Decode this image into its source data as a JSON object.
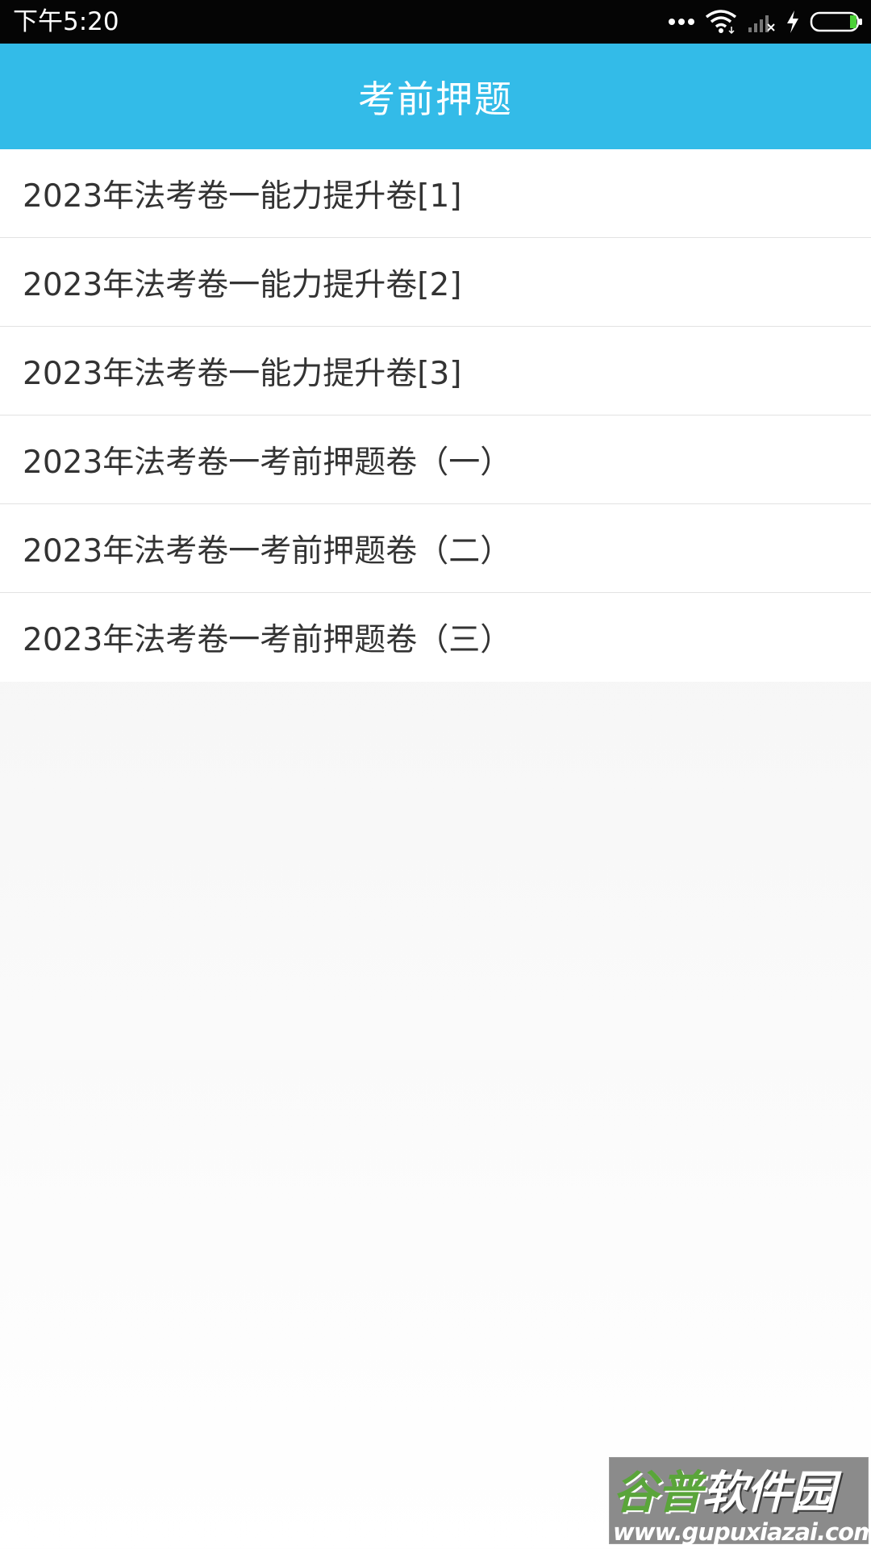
{
  "status_bar": {
    "time": "下午5:20",
    "icons": [
      "more-dots-icon",
      "wifi-icon",
      "cellular-no-signal-icon",
      "charging-icon",
      "battery-icon"
    ],
    "battery_color": "#4cd137"
  },
  "header": {
    "title": "考前押题",
    "background_color": "#33bbe8"
  },
  "papers": [
    {
      "label": "2023年法考卷一能力提升卷[1]"
    },
    {
      "label": "2023年法考卷一能力提升卷[2]"
    },
    {
      "label": "2023年法考卷一能力提升卷[3]"
    },
    {
      "label": "2023年法考卷一考前押题卷（一）"
    },
    {
      "label": "2023年法考卷一考前押题卷（二）"
    },
    {
      "label": "2023年法考卷一考前押题卷（三）"
    }
  ],
  "watermark": {
    "logo_green": "谷普",
    "logo_white": "软件园",
    "url": "www.gupuxiazai.com"
  }
}
